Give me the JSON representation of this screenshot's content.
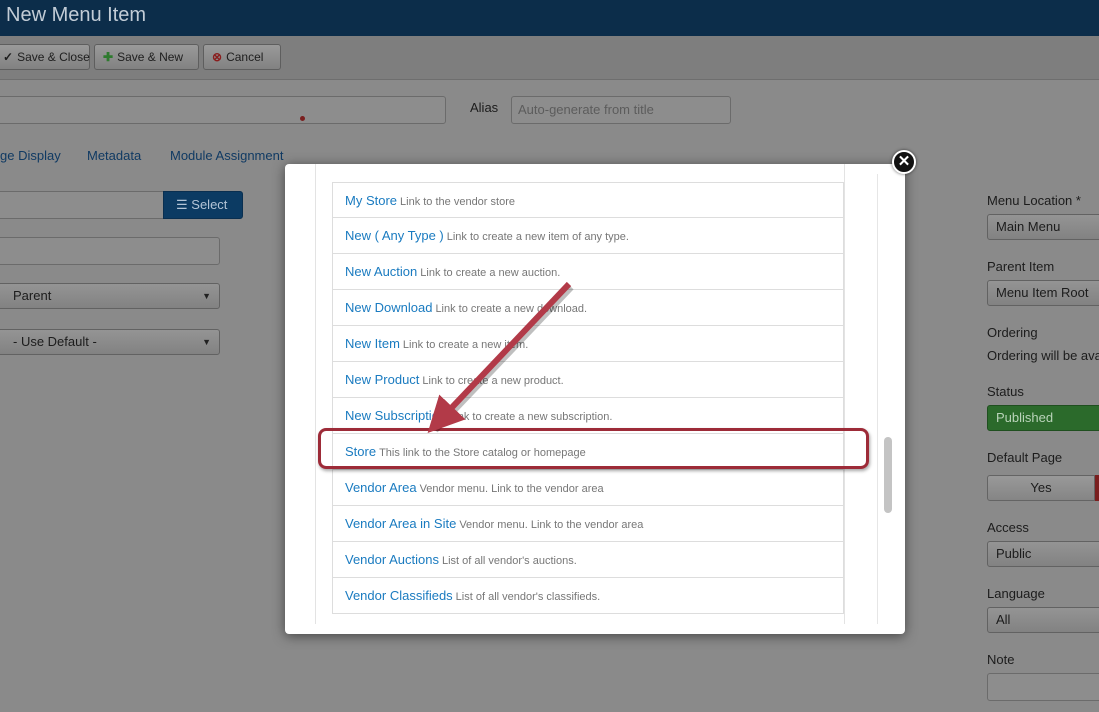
{
  "header": {
    "title": "New Menu Item"
  },
  "toolbar": {
    "save_close": "Save & Close",
    "save_new": "Save & New",
    "cancel": "Cancel"
  },
  "form": {
    "alias_label": "Alias",
    "alias_placeholder": "Auto-generate from title",
    "tabs": [
      "ge Display",
      "Metadata",
      "Module Assignment"
    ],
    "select_button": "Select",
    "parent_select": "Parent",
    "default_select": "- Use Default -"
  },
  "sidebar": {
    "menu_location_label": "Menu Location *",
    "menu_location_value": "Main Menu",
    "parent_item_label": "Parent Item",
    "parent_item_value": "Menu Item Root",
    "ordering_label": "Ordering",
    "ordering_text": "Ordering will be ava",
    "status_label": "Status",
    "status_value": "Published",
    "default_page_label": "Default Page",
    "default_page_value": "Yes",
    "access_label": "Access",
    "access_value": "Public",
    "language_label": "Language",
    "language_value": "All",
    "note_label": "Note"
  },
  "modal": {
    "items": [
      {
        "title": "My Store",
        "desc": "Link to the vendor store"
      },
      {
        "title": "New ( Any Type )",
        "desc": "Link to create a new item of any type."
      },
      {
        "title": "New Auction",
        "desc": "Link to create a new auction."
      },
      {
        "title": "New Download",
        "desc": "Link to create a new download."
      },
      {
        "title": "New Item",
        "desc": "Link to create a new item."
      },
      {
        "title": "New Product",
        "desc": "Link to create a new product."
      },
      {
        "title": "New Subscription",
        "desc": "Link to create a new subscription."
      },
      {
        "title": "Store",
        "desc": "This link to the Store catalog or homepage"
      },
      {
        "title": "Vendor Area",
        "desc": "Vendor menu. Link to the vendor area"
      },
      {
        "title": "Vendor Area in Site",
        "desc": "Vendor menu. Link to the vendor area"
      },
      {
        "title": "Vendor Auctions",
        "desc": "List of all vendor's auctions."
      },
      {
        "title": "Vendor Classifieds",
        "desc": "List of all vendor's classifieds."
      }
    ]
  },
  "icons": {
    "close": "close-icon",
    "save_new": "plus-icon",
    "cancel": "cancel-icon",
    "select": "list-icon"
  },
  "colors": {
    "accent_link": "#1a7bc0",
    "highlight": "#9d2b38",
    "header_bg": "#0c2d4a"
  }
}
